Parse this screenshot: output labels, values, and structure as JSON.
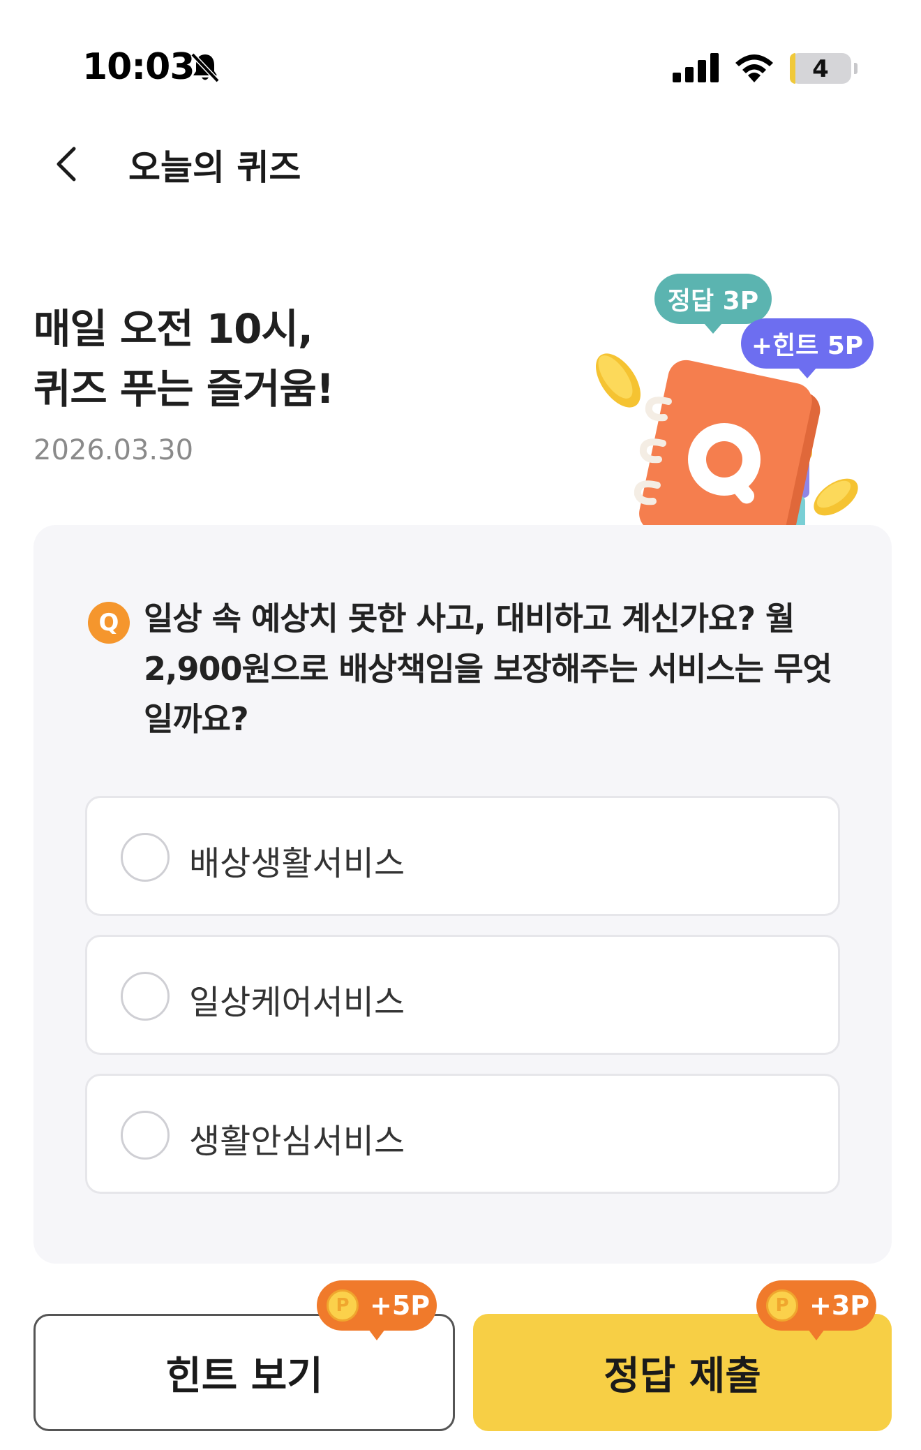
{
  "status_bar": {
    "time": "10:03",
    "battery": "4"
  },
  "header": {
    "title": "오늘의 퀴즈"
  },
  "hero": {
    "title_line1": "매일 오전 10시,",
    "title_line2": "퀴즈 푸는 즐거움!",
    "date": "2026.03.30",
    "bubble_answer": "정답 3P",
    "bubble_hint": "+힌트 5P"
  },
  "quiz": {
    "badge": "Q",
    "question": "일상 속 예상치 못한 사고, 대비하고 계신가요? 월 2,900원으로 배상책임을 보장해주는 서비스는 무엇일까요?",
    "options": [
      {
        "label": "배상생활서비스"
      },
      {
        "label": "일상케어서비스"
      },
      {
        "label": "생활안심서비스"
      }
    ]
  },
  "actions": {
    "hint_label": "힌트 보기",
    "hint_reward": "+5P",
    "submit_label": "정답 제출",
    "submit_reward": "+3P",
    "coin_symbol": "P"
  },
  "colors": {
    "accent_yellow": "#f7cf45",
    "accent_orange": "#f07a2b",
    "bubble_teal": "#5bb4b0",
    "bubble_purple": "#6d6ef0",
    "card_background": "#f6f6f9"
  },
  "icons": {
    "back": "chevron-left-icon",
    "silent": "bell-slash-icon",
    "signal": "cellular-signal-icon",
    "wifi": "wifi-icon",
    "battery": "battery-icon",
    "coin": "point-coin-icon"
  }
}
